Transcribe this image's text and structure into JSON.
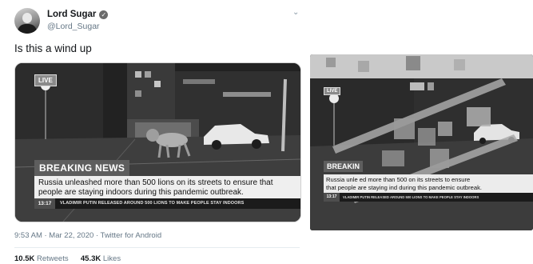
{
  "tweet": {
    "display_name": "Lord Sugar",
    "handle": "@Lord_Sugar",
    "text": "Is this a wind up",
    "timestamp": "9:53 AM · Mar 22, 2020 · Twitter for Android",
    "retweets_count": "10.5K",
    "retweets_label": "Retweets",
    "likes_count": "45.3K",
    "likes_label": "Likes"
  },
  "media": {
    "live_badge": "LIVE",
    "breaking_label": "BREAKING NEWS",
    "headline": "Russia unleashed more than 500 lions on its streets to ensure that people are staying indoors during this pandemic outbreak.",
    "ticker_time": "13:17",
    "ticker_text": "VLADIMIR PUTIN RELEASED AROUND 500 LIONS TO MAKE PEOPLE STAY INDOORS"
  },
  "comparison": {
    "live_badge": "LIVE",
    "breaking_label": "BREAKIN",
    "headline_line1": "Russia unle    ed more than 500     on its streets to ensure",
    "headline_line2": "that people are staying ind     during this pandemic outbreak.",
    "ticker_time": "13:17",
    "ticker_text": "VLADIMIR PUTIN RELEASED AROUND 500 LIONS TO MAKE PEOPLE STAY INDOORS"
  },
  "icons": [
    "verified-badge-icon",
    "chevron-down-icon"
  ]
}
